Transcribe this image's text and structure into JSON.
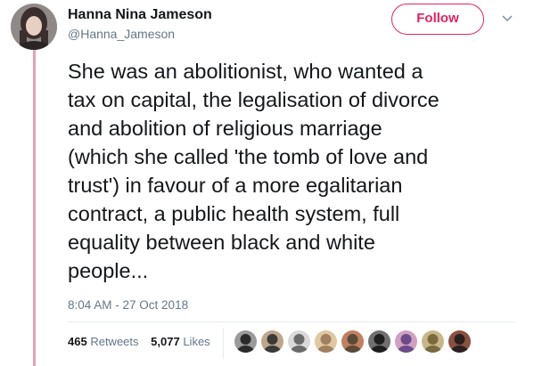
{
  "user": {
    "display_name": "Hanna Nina Jameson",
    "handle": "@Hanna_Jameson"
  },
  "follow_label": "Follow",
  "tweet_text": "She was an abolitionist, who wanted a\ntax on capital, the legalisation of divorce\nand abolition of religious marriage\n(which she called 'the tomb of love and\ntrust') in favour of a more egalitarian\ncontract, a public health system, full\nequality between black and white\npeople...",
  "timestamp": "8:04 AM - 27 Oct 2018",
  "stats": {
    "retweets_count": "465",
    "retweets_label": "Retweets",
    "likes_count": "5,077",
    "likes_label": "Likes"
  },
  "colors": {
    "accent": "#e0245e",
    "thread_line": "#e8a1b0",
    "secondary_text": "#657786"
  },
  "liker_avatars": [
    {
      "name": "liker-avatar-1",
      "colors": [
        "#2b2b2b",
        "#9a9a9a"
      ]
    },
    {
      "name": "liker-avatar-2",
      "colors": [
        "#3a3a3a",
        "#bfa58a"
      ]
    },
    {
      "name": "liker-avatar-3",
      "colors": [
        "#6a6a6a",
        "#d9d9d9"
      ]
    },
    {
      "name": "liker-avatar-4",
      "colors": [
        "#a08060",
        "#e0c8a0"
      ]
    },
    {
      "name": "liker-avatar-5",
      "colors": [
        "#5a4a3a",
        "#c08060"
      ]
    },
    {
      "name": "liker-avatar-6",
      "colors": [
        "#1f1f1f",
        "#707070"
      ]
    },
    {
      "name": "liker-avatar-7",
      "colors": [
        "#6b4b8a",
        "#d0a0c0"
      ]
    },
    {
      "name": "liker-avatar-8",
      "colors": [
        "#7a6a40",
        "#c8b888"
      ]
    },
    {
      "name": "liker-avatar-9",
      "colors": [
        "#2a2020",
        "#8a5040"
      ]
    }
  ]
}
